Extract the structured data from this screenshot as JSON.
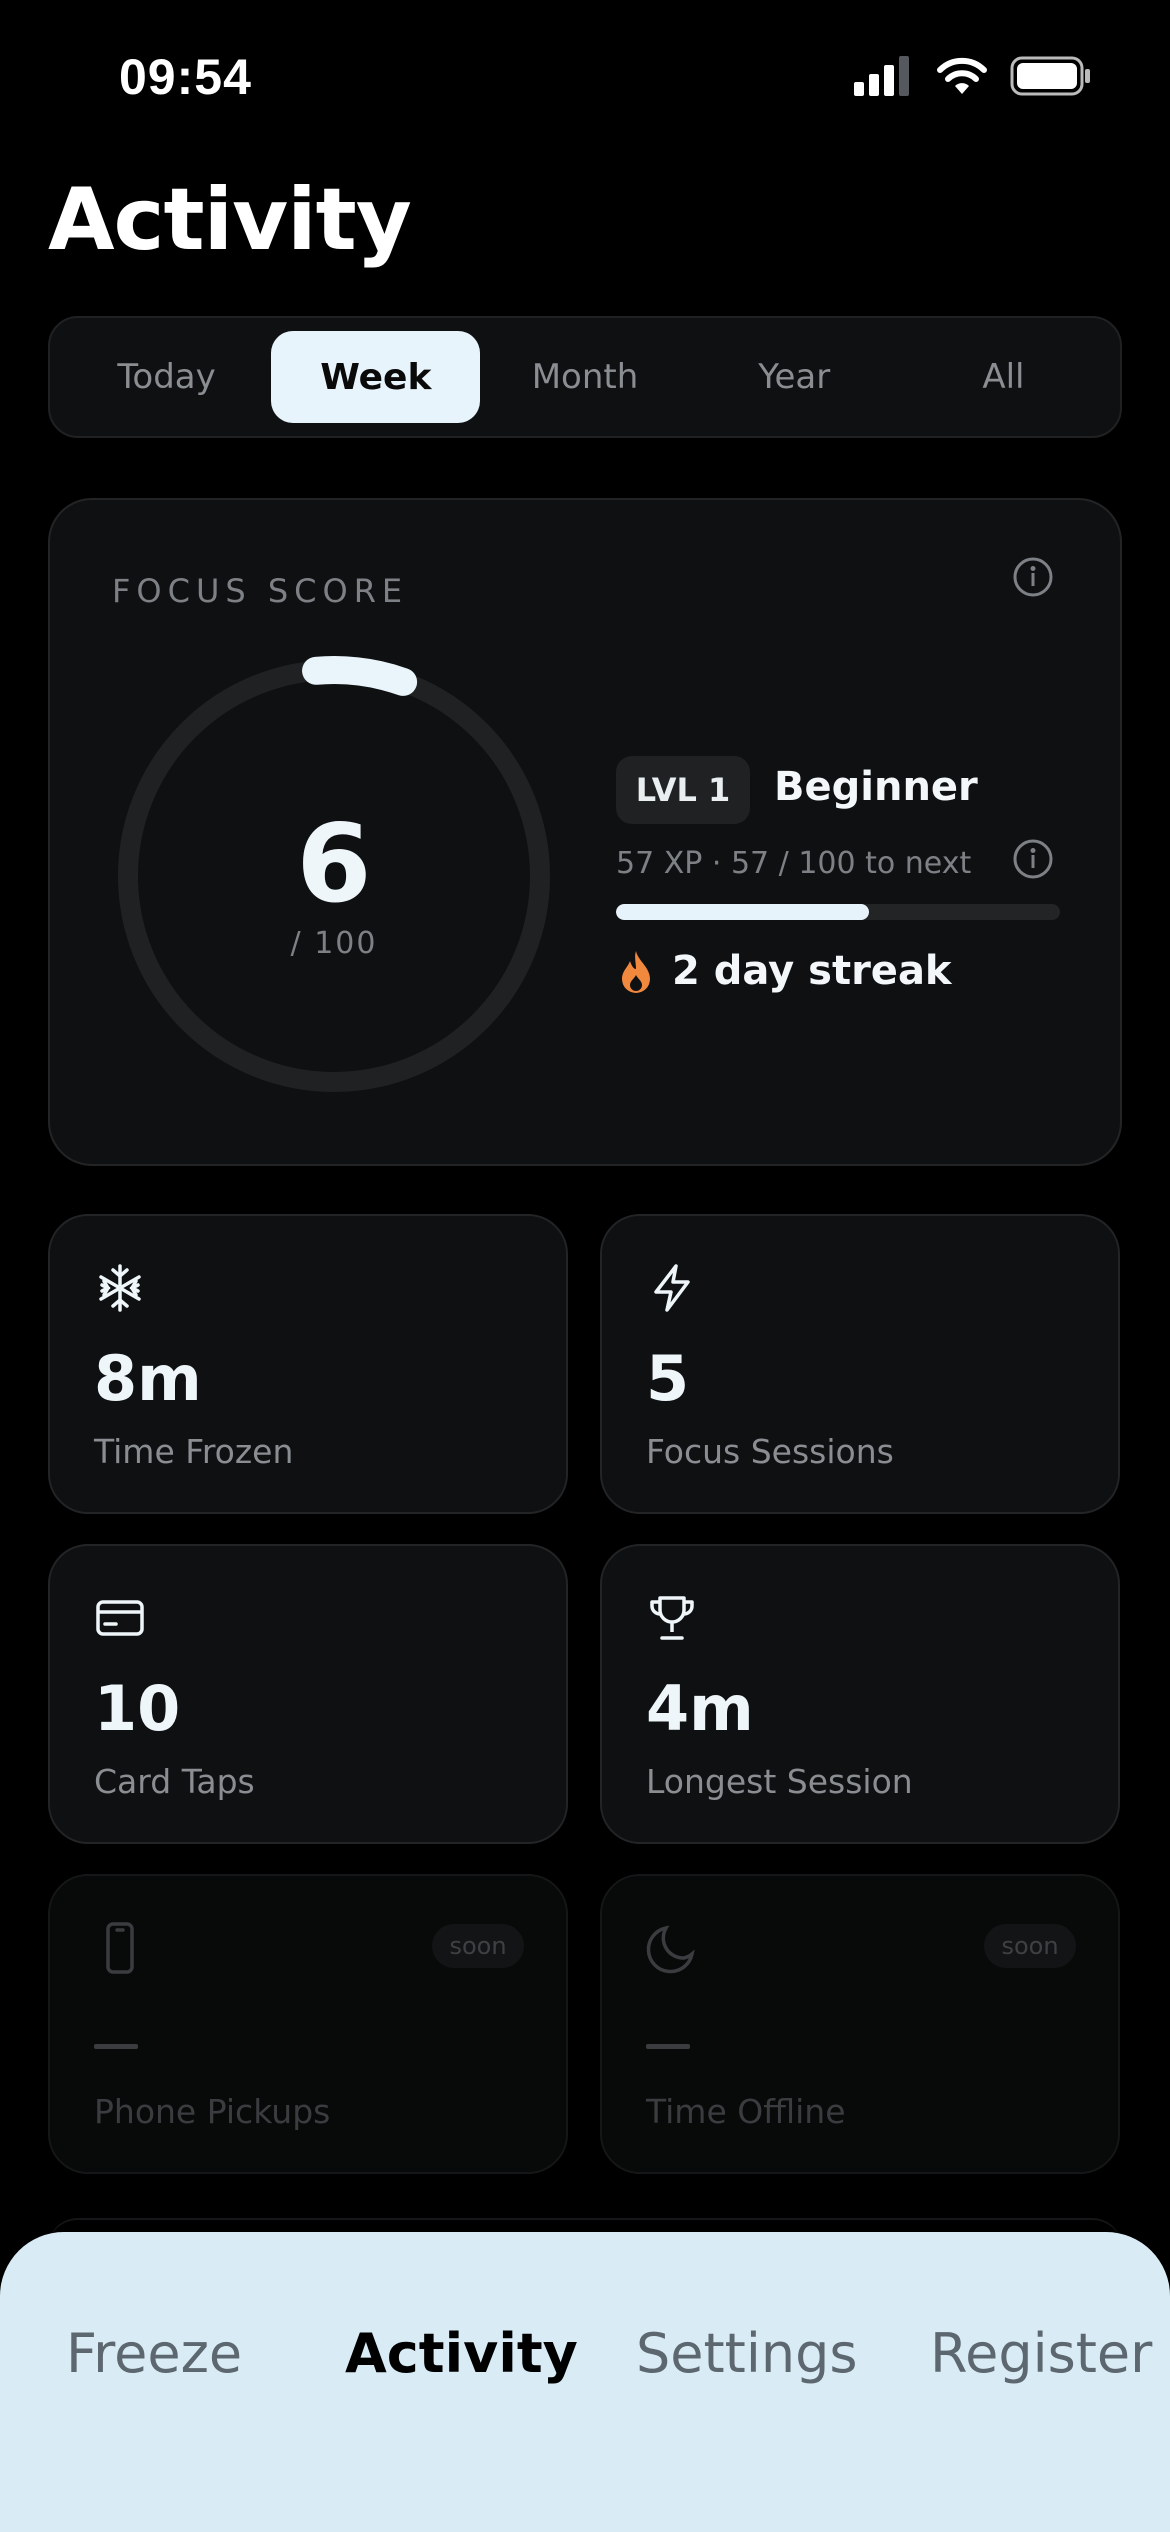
{
  "status_bar": {
    "time": "09:54",
    "battery_icon": "battery-icon",
    "wifi_icon": "wifi-icon",
    "signal_icon": "signal-icon"
  },
  "page_title": "Activity",
  "segments": [
    {
      "label": "Today",
      "active": false
    },
    {
      "label": "Week",
      "active": true
    },
    {
      "label": "Month",
      "active": false
    },
    {
      "label": "Year",
      "active": false
    },
    {
      "label": "All",
      "active": false
    }
  ],
  "focus_score": {
    "label": "FOCUS SCORE",
    "score": "6",
    "total": "/ 100",
    "score_fraction": 0.06,
    "level_badge": "LVL 1",
    "level_name": "Beginner",
    "xp_text": "57 XP · 57 / 100 to next",
    "xp_fraction": 0.57,
    "streak_text": "2 day streak",
    "streak_icon": "flame-icon"
  },
  "stats": [
    {
      "icon": "snowflake-icon",
      "value": "8m",
      "label": "Time Frozen"
    },
    {
      "icon": "lightning-icon",
      "value": "5",
      "label": "Focus Sessions"
    },
    {
      "icon": "card-icon",
      "value": "10",
      "label": "Card Taps"
    },
    {
      "icon": "trophy-icon",
      "value": "4m",
      "label": "Longest Session"
    }
  ],
  "coming_soon": [
    {
      "icon": "phone-icon",
      "value": "—",
      "label": "Phone Pickups",
      "badge": "soon"
    },
    {
      "icon": "moon-icon",
      "value": "—",
      "label": "Time Offline",
      "badge": "soon"
    }
  ],
  "tabs": [
    {
      "label": "Freeze",
      "active": false
    },
    {
      "label": "Activity",
      "active": true
    },
    {
      "label": "Settings",
      "active": false
    },
    {
      "label": "Register",
      "active": false
    }
  ],
  "colors": {
    "accent": "#e6f3fa",
    "flame": "#f0883e",
    "tabbar": "#d9ecf6"
  }
}
